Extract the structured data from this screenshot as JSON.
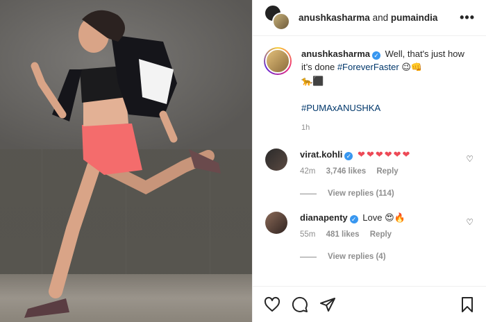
{
  "header": {
    "user1": "anushkasharma",
    "and_text": "and",
    "user2": "pumaindia",
    "more": "•••"
  },
  "caption": {
    "username": "anushkasharma",
    "text1": "Well, that's just how it’s done",
    "hashtag1": "#ForeverFaster",
    "emoji1": "😉👊",
    "emoji2": "🐆⬛",
    "hashtag2": "#PUMAxANUSHKA",
    "time": "1h"
  },
  "comments": [
    {
      "username": "virat.kohli",
      "text": "❤❤❤❤❤❤",
      "time": "42m",
      "likes": "3,746 likes",
      "reply": "Reply",
      "view_replies": "View replies (114)"
    },
    {
      "username": "dianapenty",
      "text": "Love",
      "emoji": "😍🔥",
      "time": "55m",
      "likes": "481 likes",
      "reply": "Reply",
      "view_replies": "View replies (4)"
    }
  ],
  "icons": [
    "like-icon",
    "comment-icon",
    "share-icon",
    "save-icon",
    "heart-icon",
    "verified-icon",
    "more-icon"
  ],
  "colors": {
    "link": "#00376b",
    "verified": "#3897f0",
    "heart": "#ed4956",
    "muted": "#8e8e8e"
  }
}
